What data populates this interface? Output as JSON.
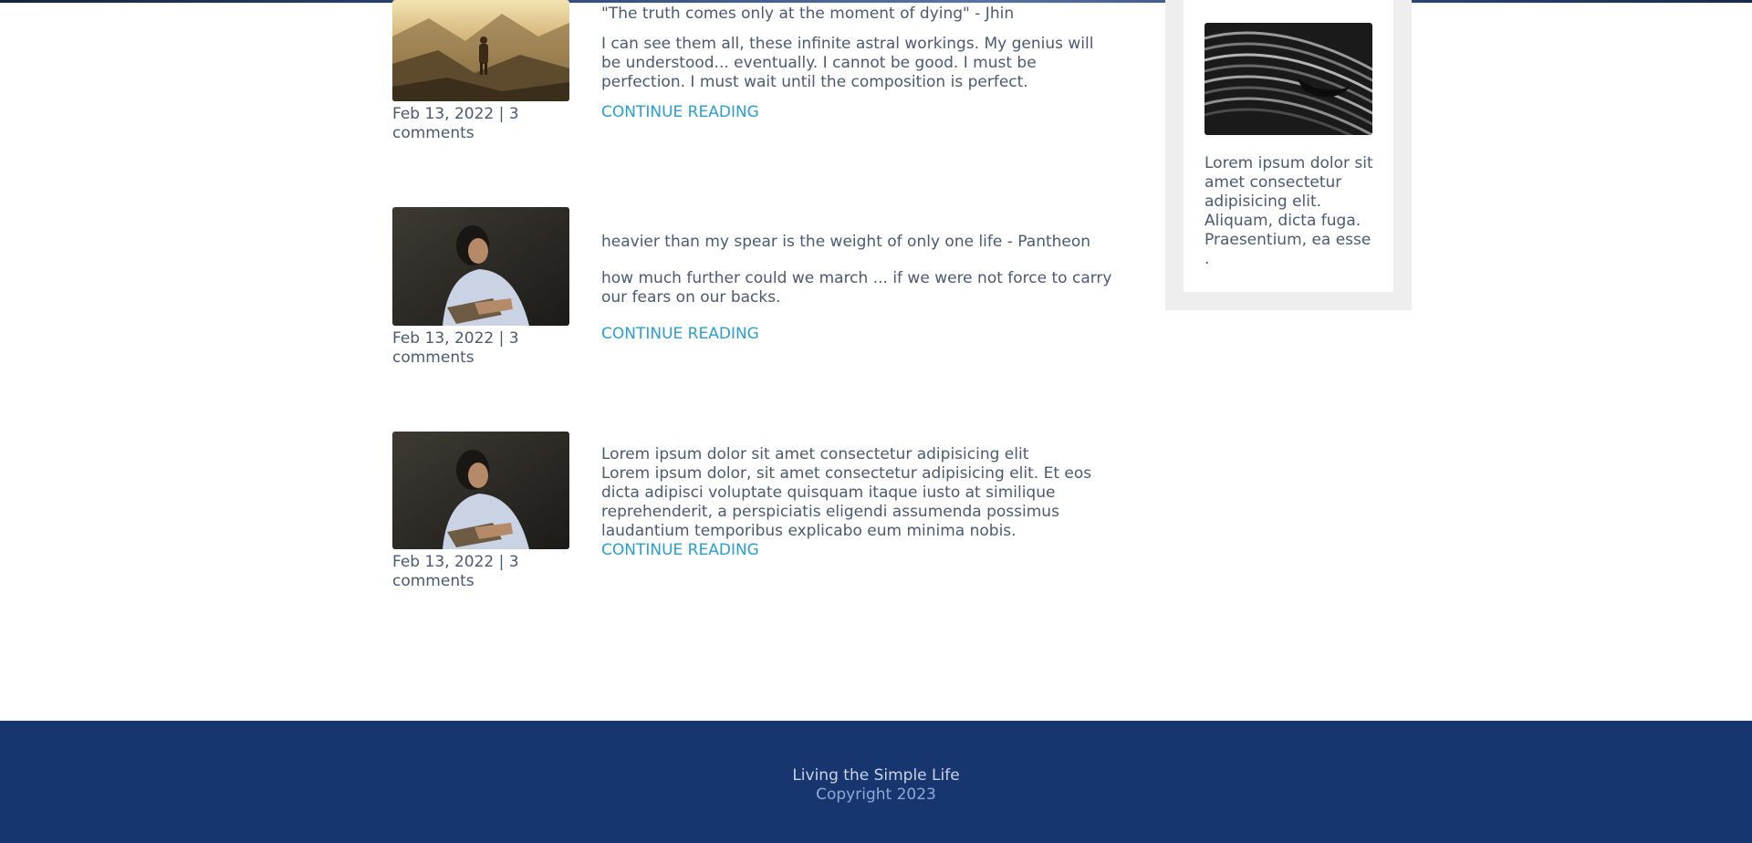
{
  "posts": [
    {
      "image": "mountain-hiker-photo",
      "title": "\"The truth comes only at the moment of dying\" - Jhin",
      "excerpt": "I can see them all, these infinite astral workings. My genius will be understood... eventually. I cannot be good. I must be perfection. I must wait until the composition is perfect.",
      "date": "Feb 13, 2022",
      "comments": "3 comments",
      "meta": "Feb 13, 2022 | 3 comments",
      "read_more": "CONTINUE READING"
    },
    {
      "image": "woman-reading-photo",
      "title": "heavier than my spear is the weight of only one life - Pantheon",
      "excerpt": "how much further could we march ... if we were not force to carry our fears on our backs.",
      "meta": "Feb 13, 2022 | 3 comments",
      "read_more": "CONTINUE READING"
    },
    {
      "image": "woman-reading-photo",
      "title": "Lorem ipsum dolor sit amet consectetur adipisicing elit",
      "excerpt": "Lorem ipsum dolor, sit amet consectetur adipisicing elit. Et eos dicta adipisci voluptate quisquam itaque iusto at similique reprehenderit, a perspiciatis eligendi assumenda possimus laudantium temporibus explicabo eum minima nobis.",
      "meta": "Feb 13, 2022 | 3 comments",
      "read_more": "CONTINUE READING"
    }
  ],
  "sidebar": {
    "image": "abstract-architecture-photo",
    "text": "Lorem ipsum dolor sit amet consectetur adipisicing elit. Aliquam, dicta fuga. Praesentium, ea esse ."
  },
  "footer": {
    "title": "Living the Simple Life",
    "copyright": "Copyright 2023"
  },
  "colors": {
    "text": "#4a5a72",
    "link": "#2a9fd0",
    "footer_bg": "#17356f",
    "sidebar_bg": "#eeeeee"
  }
}
